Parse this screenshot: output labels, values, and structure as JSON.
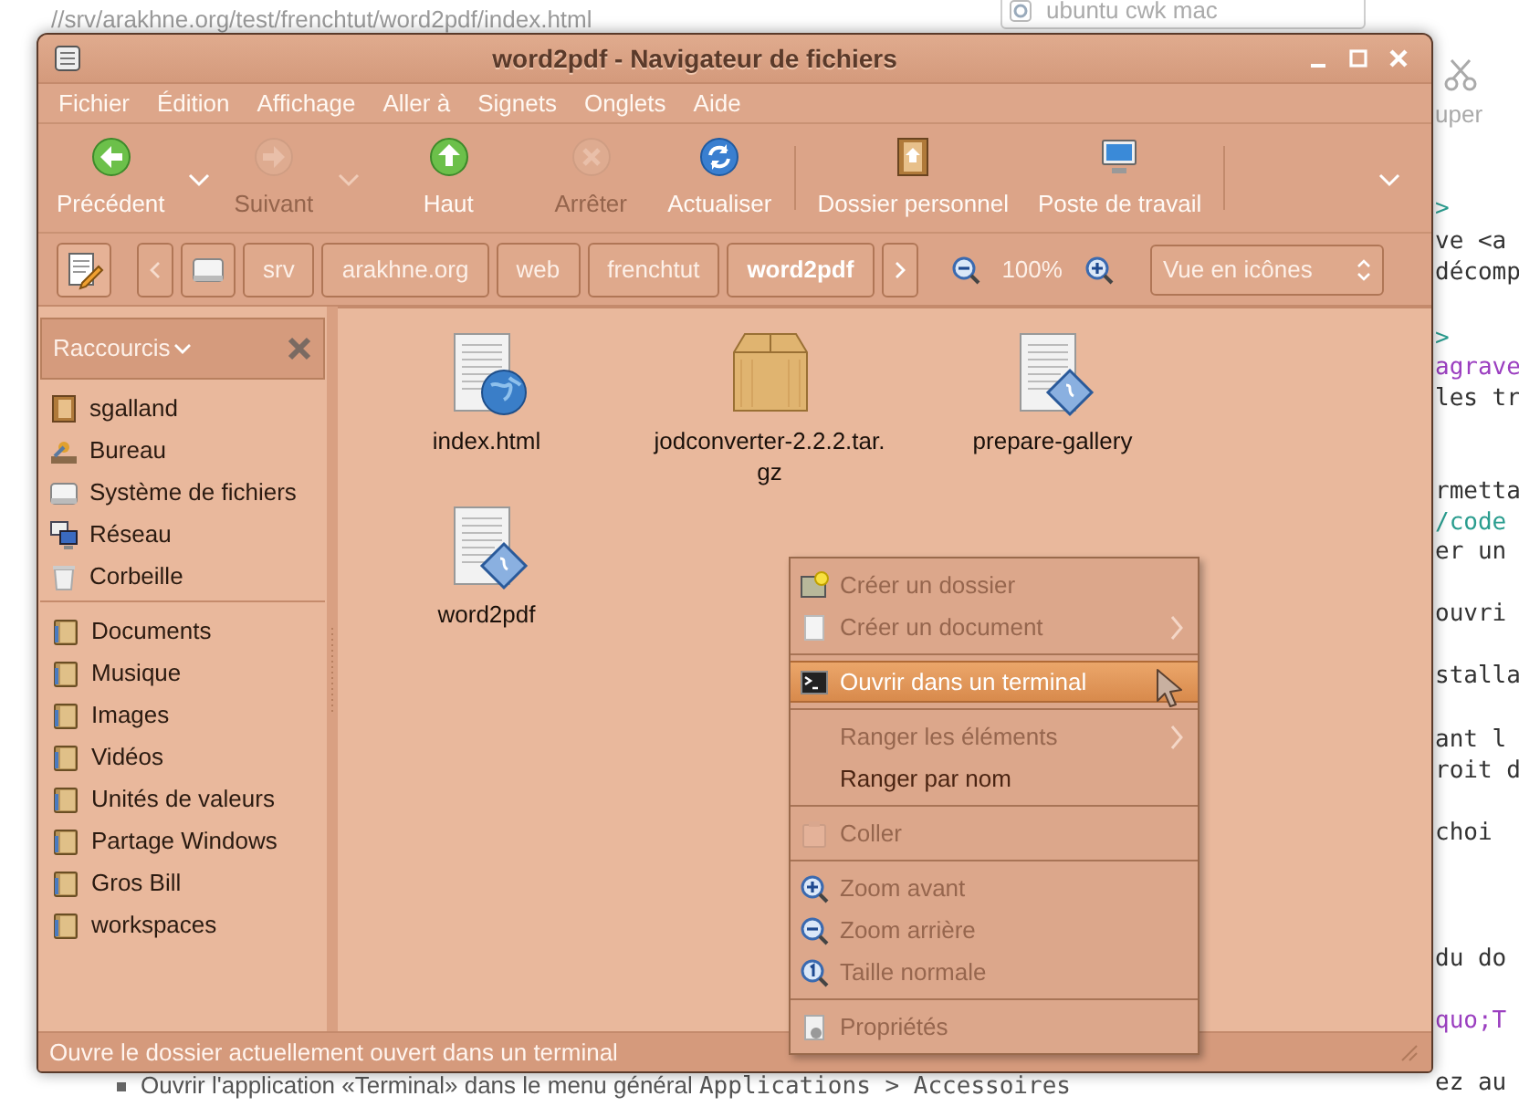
{
  "background_page": {
    "address": "//srv/arakhne.org/test/frenchtut/word2pdf/index.html",
    "search": "ubuntu cwk mac",
    "toolbar_label": "uper",
    "right_fragments": [
      {
        "text": ">",
        "color": "#2a9d8f"
      },
      {
        "text": "ve <a",
        "color": "#333333"
      },
      {
        "text": "décomp",
        "color": "#333333"
      },
      {
        "text": ">",
        "color": "#2a9d8f"
      },
      {
        "text": "agrave",
        "color": "#9b3fc0"
      },
      {
        "text": "les tr",
        "color": "#333333"
      },
      {
        "text": "rmetta",
        "color": "#333333"
      },
      {
        "text": "/code",
        "color": "#2a9d8f"
      },
      {
        "text": "er un",
        "color": "#333333"
      },
      {
        "text": "ouvri",
        "color": "#333333"
      },
      {
        "text": "stalla",
        "color": "#333333"
      },
      {
        "text": "ant l",
        "color": "#333333"
      },
      {
        "text": "roit d",
        "color": "#333333"
      },
      {
        "text": "choi",
        "color": "#333333"
      },
      {
        "text": "du do",
        "color": "#333333"
      },
      {
        "text": "quo;T",
        "color": "#9b3fc0"
      },
      {
        "text": "ez au",
        "color": "#333333"
      }
    ],
    "bullets": [
      {
        "text": "Ouvrir l'application «Terminal» dans le menu général ",
        "code": "Applications > Accessoires"
      }
    ]
  },
  "window": {
    "title": "word2pdf - Navigateur de fichiers"
  },
  "menu": [
    "Fichier",
    "Édition",
    "Affichage",
    "Aller à",
    "Signets",
    "Onglets",
    "Aide"
  ],
  "toolbar": [
    {
      "kind": "back",
      "label": "Précédent",
      "disabled": false,
      "dropdown": true
    },
    {
      "kind": "forward",
      "label": "Suivant",
      "disabled": true,
      "dropdown": true
    },
    {
      "kind": "up",
      "label": "Haut",
      "disabled": false,
      "dropdown": false
    },
    {
      "kind": "stop",
      "label": "Arrêter",
      "disabled": true,
      "dropdown": false
    },
    {
      "kind": "reload",
      "label": "Actualiser",
      "disabled": false,
      "dropdown": false
    },
    {
      "kind": "separator"
    },
    {
      "kind": "home",
      "label": "Dossier personnel",
      "disabled": false,
      "dropdown": false
    },
    {
      "kind": "computer",
      "label": "Poste de travail",
      "disabled": false,
      "dropdown": false
    },
    {
      "kind": "separator"
    },
    {
      "kind": "overflow"
    }
  ],
  "location": {
    "crumbs": [
      {
        "label": "srv",
        "selected": false
      },
      {
        "label": "arakhne.org",
        "selected": false
      },
      {
        "label": "web",
        "selected": false
      },
      {
        "label": "frenchtut",
        "selected": false
      },
      {
        "label": "word2pdf",
        "selected": true
      }
    ],
    "zoom": "100%",
    "view": "Vue en icônes"
  },
  "sidebar": {
    "title": "Raccourcis",
    "groups": [
      [
        {
          "kind": "home",
          "label": "sgalland"
        },
        {
          "kind": "desktop",
          "label": "Bureau"
        },
        {
          "kind": "drive",
          "label": "Système de fichiers"
        },
        {
          "kind": "network",
          "label": "Réseau"
        },
        {
          "kind": "trash",
          "label": "Corbeille"
        }
      ],
      [
        {
          "kind": "folder",
          "label": "Documents"
        },
        {
          "kind": "folder",
          "label": "Musique"
        },
        {
          "kind": "folder",
          "label": "Images"
        },
        {
          "kind": "folder",
          "label": "Vidéos"
        },
        {
          "kind": "folder",
          "label": "Unités de valeurs"
        },
        {
          "kind": "folder",
          "label": "Partage Windows"
        },
        {
          "kind": "folder",
          "label": "Gros Bill"
        },
        {
          "kind": "folder",
          "label": "workspaces"
        }
      ]
    ]
  },
  "files": [
    {
      "kind": "web",
      "name": "index.html"
    },
    {
      "kind": "archive",
      "name": "jodconverter-2.2.2.tar.gz"
    },
    {
      "kind": "script",
      "name": "prepare-gallery"
    },
    {
      "kind": "script",
      "name": "word2pdf"
    }
  ],
  "context_menu": [
    {
      "kind": "new-folder",
      "label": "Créer un dossier",
      "disabled": true,
      "submenu": false,
      "selected": false
    },
    {
      "kind": "new-document",
      "label": "Créer un document",
      "disabled": true,
      "submenu": true,
      "selected": false
    },
    {
      "kind": "separator"
    },
    {
      "kind": "terminal",
      "label": "Ouvrir dans un terminal",
      "disabled": false,
      "submenu": false,
      "selected": true
    },
    {
      "kind": "separator"
    },
    {
      "kind": "plain",
      "label": "Ranger les éléments",
      "disabled": true,
      "submenu": true,
      "selected": false
    },
    {
      "kind": "plain",
      "label": "Ranger par nom",
      "disabled": false,
      "submenu": false,
      "selected": false
    },
    {
      "kind": "separator"
    },
    {
      "kind": "paste",
      "label": "Coller",
      "disabled": true,
      "submenu": false,
      "selected": false
    },
    {
      "kind": "separator"
    },
    {
      "kind": "zoom-in",
      "label": "Zoom avant",
      "disabled": true,
      "submenu": false,
      "selected": false
    },
    {
      "kind": "zoom-out",
      "label": "Zoom arrière",
      "disabled": true,
      "submenu": false,
      "selected": false
    },
    {
      "kind": "zoom-normal",
      "label": "Taille normale",
      "disabled": true,
      "submenu": false,
      "selected": false
    },
    {
      "kind": "separator"
    },
    {
      "kind": "properties",
      "label": "Propriétés",
      "disabled": true,
      "submenu": false,
      "selected": false
    }
  ],
  "status_bar": "Ouvre le dossier actuellement ouvert dans un terminal"
}
